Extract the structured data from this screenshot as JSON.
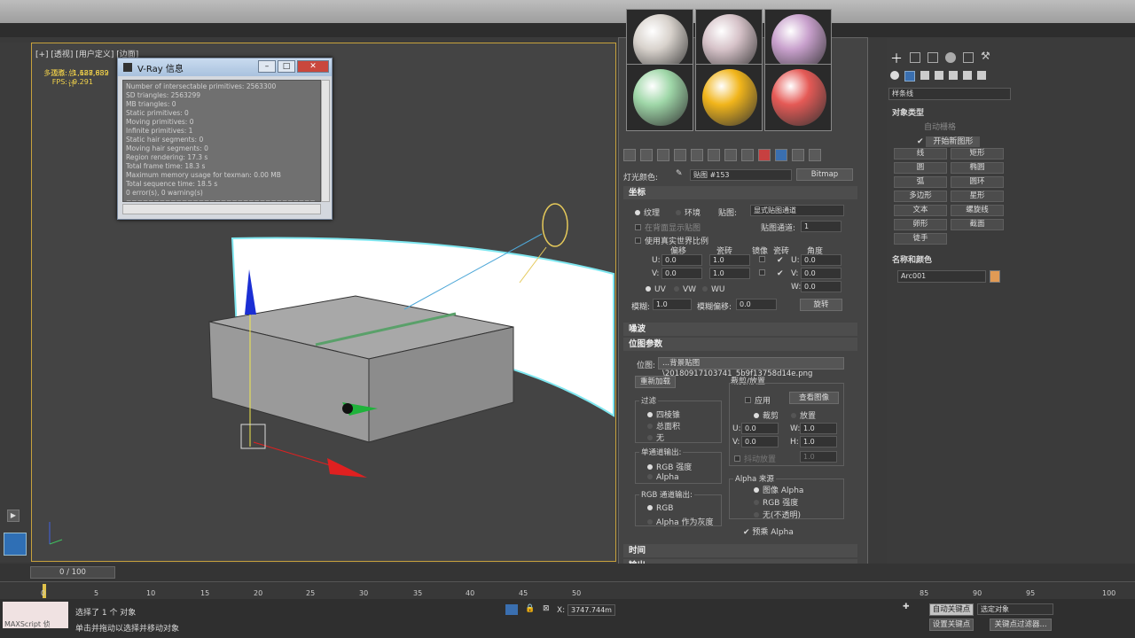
{
  "viewport": {
    "label": "[+] [透视] [用户定义] [边面]",
    "stats": {
      "total": "总计",
      "poly_label": "多边形:",
      "poly_value": "1,688,682",
      "vert_label": "顶点:",
      "vert_value": "1,127,839",
      "fps_label": "FPS:",
      "fps_value": "9.291"
    }
  },
  "vray": {
    "title": "V-Ray 信息",
    "lines": [
      "Number of intersectable primitives: 2563300",
      "SD triangles: 2563299",
      "MB triangles: 0",
      "Static primitives: 0",
      "Moving primitives: 0",
      "Infinite primitives: 1",
      "Static hair segments: 0",
      "Moving hair segments: 0",
      "Region rendering: 17.3 s",
      "Total frame time: 18.3 s",
      "Maximum memory usage for texman: 0.00 MB",
      "Total sequence time: 18.5 s",
      "0 error(s), 0 warning(s)",
      "=================================="
    ]
  },
  "materials": {
    "spheres": [
      "#d8d2cc",
      "#d6c2c8",
      "#c8a0cc",
      "#9fd7a8",
      "#f1b51b",
      "#e55a56"
    ]
  },
  "editor": {
    "light_color_label": "灯光颜色:",
    "map_name": "贴图 #153",
    "map_type": "Bitmap",
    "coords": {
      "title": "坐标",
      "texture": "纹理",
      "environment": "环境",
      "mapping_label": "贴图:",
      "mapping_value": "显式贴图通道",
      "show_in_viewport": "在背面显示贴图",
      "map_channel_label": "贴图通道:",
      "map_channel_value": "1",
      "real_world": "使用真实世界比例",
      "offset": "偏移",
      "tiling": "瓷砖",
      "mirror": "镜像",
      "tile2": "瓷砖",
      "angle": "角度",
      "u": "U:",
      "v": "V:",
      "w": "W:",
      "u_offset": "0.0",
      "v_offset": "0.0",
      "u_tile": "1.0",
      "v_tile": "1.0",
      "u_angle": "0.0",
      "v_angle": "0.0",
      "w_angle": "0.0",
      "uv": "UV",
      "vw": "VW",
      "wu": "WU",
      "blur_label": "模糊:",
      "blur_value": "1.0",
      "blur_offset_label": "模糊偏移:",
      "blur_offset_value": "0.0",
      "rotate": "旋转"
    },
    "noise": "噪波",
    "bitmap_params": {
      "title": "位图参数",
      "bitmap_label": "位图:",
      "bitmap_path": "...背景贴图\\20180917103741_5b9f13758d14e.png",
      "reload": "重新加载",
      "crop_place": "裁剪/放置",
      "apply": "应用",
      "view_image": "查看图像",
      "crop": "裁剪",
      "place": "放置",
      "u_val": "0.0",
      "v_val": "0.0",
      "w_label": "W:",
      "h_label": "H:",
      "w_val": "1.0",
      "h_val": "1.0",
      "jitter": "抖动放置",
      "jitter_val": "1.0",
      "filter": "过滤",
      "pyramidal": "四棱锥",
      "summed": "总面积",
      "none": "无",
      "mono_out": "单通道输出:",
      "rgb_intensity": "RGB 强度",
      "alpha": "Alpha",
      "rgb_out": "RGB 通道输出:",
      "rgb": "RGB",
      "alpha_gray": "Alpha 作为灰度",
      "alpha_source": "Alpha 来源",
      "image_alpha": "图像 Alpha",
      "rgb_intensity2": "RGB 强度",
      "opaque": "无(不透明)",
      "premult": "预乘 Alpha"
    },
    "time": "时间",
    "output": "输出"
  },
  "command_panel": {
    "dropdown": "样条线",
    "object_type": "对象类型",
    "auto_grid": "自动栅格",
    "start_new_shape": "开始新图形",
    "buttons": [
      "线",
      "矩形",
      "圆",
      "椭圆",
      "弧",
      "圆环",
      "多边形",
      "星形",
      "文本",
      "螺旋线",
      "卵形",
      "截面",
      "徒手"
    ],
    "name_color": "名称和颜色",
    "object_name": "Arc001",
    "object_color": "#e09a55"
  },
  "timeline": {
    "frame": "0 / 100",
    "ticks": [
      "0",
      "5",
      "10",
      "15",
      "20",
      "25",
      "30",
      "35",
      "40",
      "45",
      "50",
      "85",
      "90",
      "95",
      "100"
    ]
  },
  "status": {
    "maxscript": "MAXScript 侦",
    "selected": "选择了 1 个 对象",
    "hint": "单击并拖动以选择并移动对象",
    "x_label": "X:",
    "x_value": "3747.744m",
    "auto_key": "自动关键点",
    "selected_obj": "选定对象",
    "set_key": "设置关键点",
    "key_filters": "关键点过滤器..."
  }
}
